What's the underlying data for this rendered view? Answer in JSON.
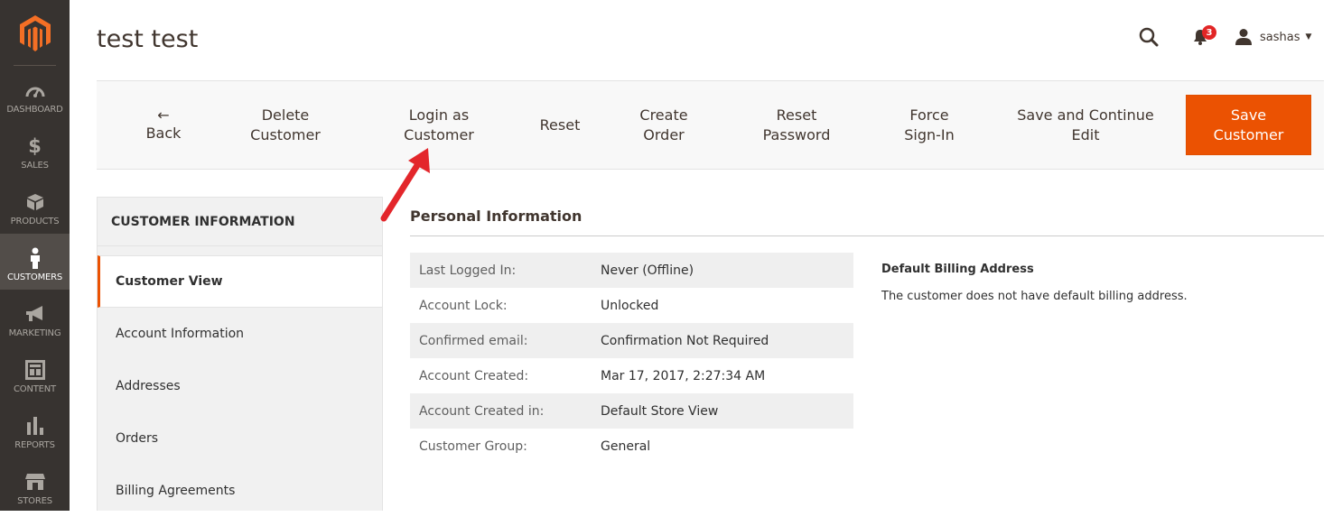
{
  "sidebar": {
    "logo": "magento-logo-icon",
    "items": [
      {
        "label": "DASHBOARD",
        "icon": "dashboard-icon"
      },
      {
        "label": "SALES",
        "icon": "dollar-icon"
      },
      {
        "label": "PRODUCTS",
        "icon": "box-icon"
      },
      {
        "label": "CUSTOMERS",
        "icon": "person-icon",
        "active": true
      },
      {
        "label": "MARKETING",
        "icon": "megaphone-icon"
      },
      {
        "label": "CONTENT",
        "icon": "layout-icon"
      },
      {
        "label": "REPORTS",
        "icon": "bar-chart-icon"
      },
      {
        "label": "STORES",
        "icon": "store-icon"
      }
    ]
  },
  "header": {
    "title": "test test",
    "notification_count": "3",
    "user_name": "sashas"
  },
  "toolbar": {
    "back": {
      "arrow": "←",
      "label": "Back"
    },
    "delete": {
      "line1": "Delete",
      "line2": "Customer"
    },
    "login_as": {
      "line1": "Login as",
      "line2": "Customer"
    },
    "reset": "Reset",
    "create_order": {
      "line1": "Create",
      "line2": "Order"
    },
    "reset_password": {
      "line1": "Reset",
      "line2": "Password"
    },
    "force_signin": {
      "line1": "Force",
      "line2": "Sign-In"
    },
    "save_continue": {
      "line1": "Save and Continue",
      "line2": "Edit"
    },
    "save": {
      "line1": "Save",
      "line2": "Customer"
    }
  },
  "tabs": {
    "title": "CUSTOMER INFORMATION",
    "items": [
      {
        "label": "Customer View",
        "active": true
      },
      {
        "label": "Account Information"
      },
      {
        "label": "Addresses"
      },
      {
        "label": "Orders"
      },
      {
        "label": "Billing Agreements"
      }
    ]
  },
  "personal": {
    "title": "Personal Information",
    "rows": [
      {
        "label": "Last Logged In:",
        "value": "Never (Offline)"
      },
      {
        "label": "Account Lock:",
        "value": "Unlocked"
      },
      {
        "label": "Confirmed email:",
        "value": "Confirmation Not Required"
      },
      {
        "label": "Account Created:",
        "value": "Mar 17, 2017, 2:27:34 AM"
      },
      {
        "label": "Account Created in:",
        "value": "Default Store View"
      },
      {
        "label": "Customer Group:",
        "value": "General"
      }
    ]
  },
  "billing": {
    "title": "Default Billing Address",
    "text": "The customer does not have default billing address."
  },
  "colors": {
    "sidebar": "#373330",
    "accent": "#eb5202",
    "annotation_arrow": "#e3262b"
  }
}
